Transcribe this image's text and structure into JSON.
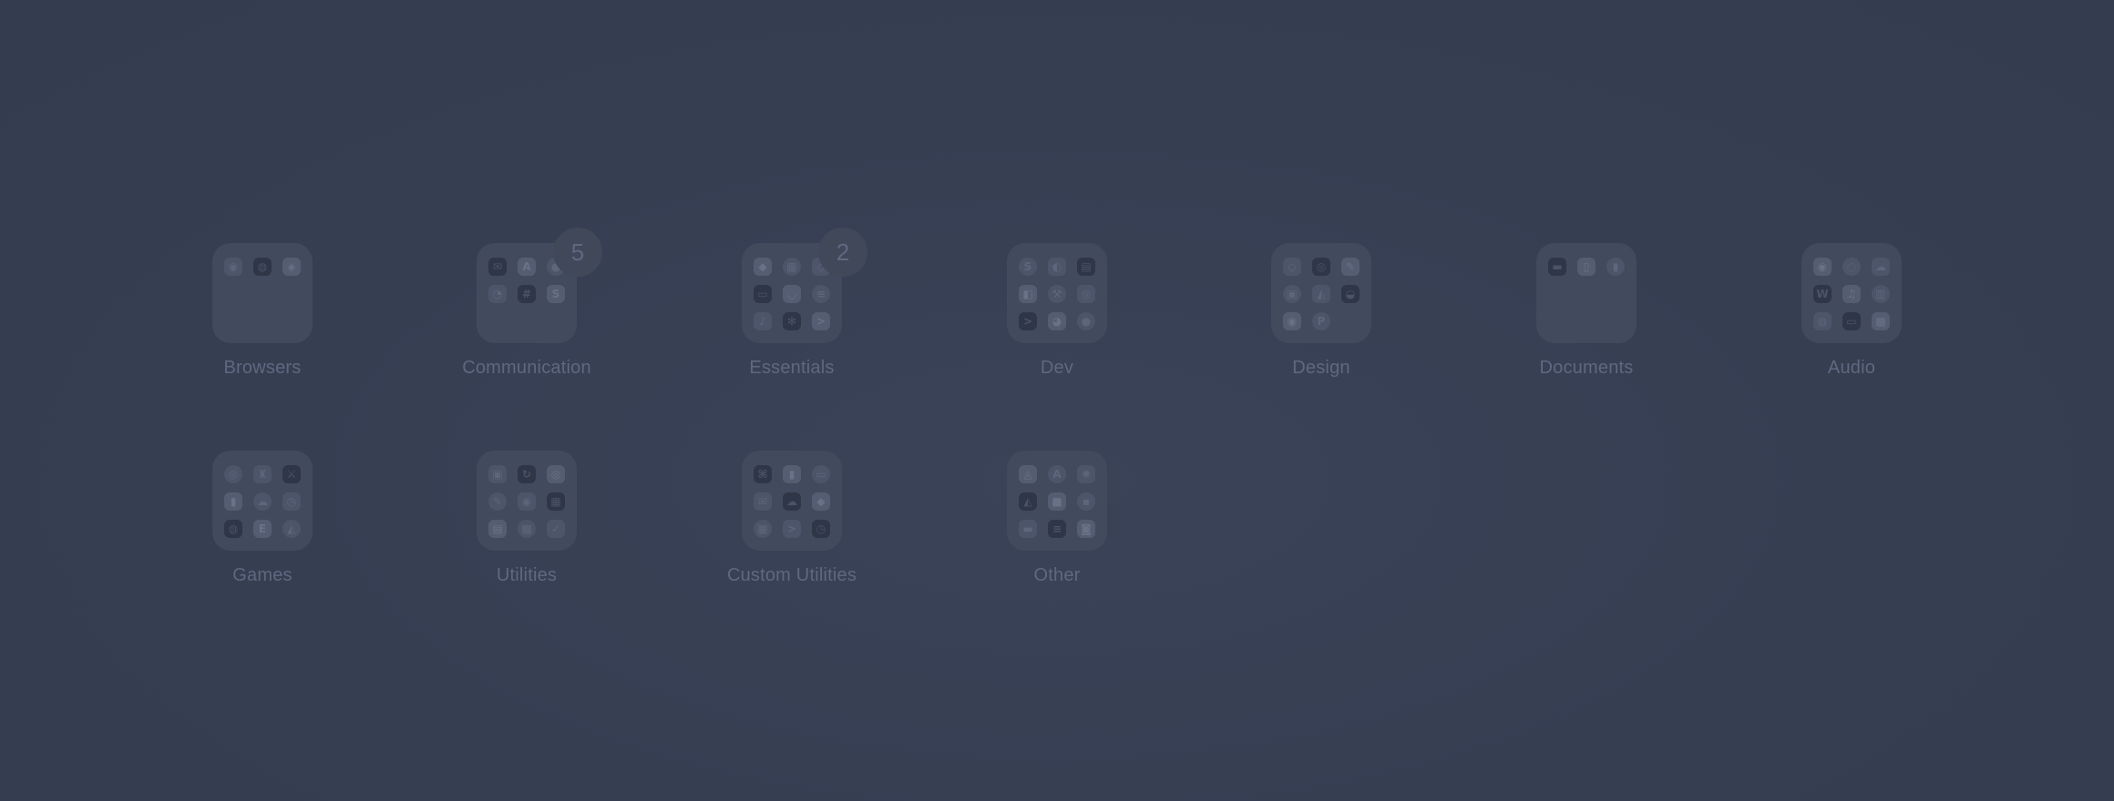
{
  "folders": [
    {
      "label": "Browsers",
      "badge": "",
      "icons": [
        "chrome-icon",
        "firefox-icon",
        "safari-icon"
      ]
    },
    {
      "label": "Communication",
      "badge": "5",
      "icons": [
        "mail-icon",
        "appstore-icon",
        "messages-icon",
        "discord-icon",
        "slack-icon",
        "skype-icon"
      ]
    },
    {
      "label": "Essentials",
      "badge": "2",
      "icons": [
        "shield-icon",
        "grid-icon",
        "dropbox-icon",
        "keyboard-icon",
        "pocket-icon",
        "notes-icon",
        "music-icon",
        "settings-icon",
        "terminal-icon"
      ]
    },
    {
      "label": "Dev",
      "badge": "",
      "icons": [
        "sublime-icon",
        "gitkraken-icon",
        "docker-icon",
        "vscode-icon",
        "xcode-icon",
        "database-icon",
        "terminal-icon",
        "github-icon",
        "postman-icon"
      ]
    },
    {
      "label": "Design",
      "badge": "",
      "icons": [
        "sketch-icon",
        "dribbble-icon",
        "pen-icon",
        "invision-icon",
        "framer-icon",
        "zeplin-icon",
        "figma-icon",
        "photoshop-icon"
      ]
    },
    {
      "label": "Documents",
      "badge": "",
      "icons": [
        "keynote-icon",
        "pages-icon",
        "numbers-icon"
      ]
    },
    {
      "label": "Audio",
      "badge": "",
      "icons": [
        "podcast-icon",
        "spotify-icon",
        "soundcloud-icon",
        "wordpress-icon",
        "audio-icon",
        "equalizer-icon",
        "globe-icon",
        "radio-icon",
        "mixer-icon"
      ]
    },
    {
      "label": "Games",
      "badge": "",
      "icons": [
        "steam-icon",
        "chess-icon",
        "sword-icon",
        "chart-icon",
        "cloud-icon",
        "clock-icon",
        "controller-icon",
        "epic-icon",
        "racing-icon"
      ]
    },
    {
      "label": "Utilities",
      "badge": "",
      "icons": [
        "monitor-icon",
        "sync-icon",
        "compass-icon",
        "pencil-icon",
        "target-icon",
        "calendar-icon",
        "archive-icon",
        "calculator-icon",
        "checkmark-icon"
      ]
    },
    {
      "label": "Custom Utilities",
      "badge": "",
      "icons": [
        "code-icon",
        "lock-icon",
        "chat-icon",
        "mail-icon",
        "cloud-icon",
        "shield-icon",
        "grid-icon",
        "terminal-icon",
        "clock-icon"
      ]
    },
    {
      "label": "Other",
      "badge": "",
      "icons": [
        "bag-icon",
        "ai-icon",
        "sun-icon",
        "map-icon",
        "square-icon",
        "box-icon",
        "card-icon",
        "notes-icon",
        "camera-icon"
      ]
    }
  ],
  "icon_glyphs": {
    "chrome-icon": "◉",
    "firefox-icon": "◍",
    "safari-icon": "◈",
    "mail-icon": "✉",
    "appstore-icon": "A",
    "messages-icon": "●",
    "discord-icon": "◔",
    "slack-icon": "#",
    "skype-icon": "S",
    "shield-icon": "◆",
    "grid-icon": "▦",
    "dropbox-icon": "◇",
    "keyboard-icon": "▭",
    "pocket-icon": "◡",
    "notes-icon": "≡",
    "music-icon": "♪",
    "settings-icon": "✻",
    "terminal-icon": ">",
    "sublime-icon": "S",
    "gitkraken-icon": "◐",
    "docker-icon": "▤",
    "vscode-icon": "◧",
    "xcode-icon": "⚒",
    "database-icon": "◎",
    "github-icon": "◕",
    "postman-icon": "●",
    "sketch-icon": "◇",
    "dribbble-icon": "◎",
    "pen-icon": "✎",
    "invision-icon": "▣",
    "framer-icon": "◭",
    "zeplin-icon": "◒",
    "figma-icon": "◉",
    "photoshop-icon": "P",
    "keynote-icon": "▬",
    "pages-icon": "▯",
    "numbers-icon": "▮",
    "podcast-icon": "◉",
    "spotify-icon": "◌",
    "soundcloud-icon": "☁",
    "wordpress-icon": "W",
    "audio-icon": "♫",
    "equalizer-icon": "▥",
    "globe-icon": "◍",
    "radio-icon": "▭",
    "mixer-icon": "▩",
    "steam-icon": "◎",
    "chess-icon": "♜",
    "sword-icon": "⚔",
    "chart-icon": "▮",
    "cloud-icon": "☁",
    "clock-icon": "◷",
    "controller-icon": "◍",
    "epic-icon": "E",
    "racing-icon": "◭",
    "monitor-icon": "▣",
    "sync-icon": "↻",
    "compass-icon": "◎",
    "pencil-icon": "✎",
    "target-icon": "◉",
    "calendar-icon": "▦",
    "archive-icon": "▤",
    "calculator-icon": "▩",
    "checkmark-icon": "✓",
    "code-icon": "⌘",
    "lock-icon": "▮",
    "chat-icon": "▭",
    "bag-icon": "◬",
    "ai-icon": "A",
    "sun-icon": "✺",
    "map-icon": "◭",
    "square-icon": "■",
    "box-icon": "▪",
    "card-icon": "▬",
    "camera-icon": "◙"
  },
  "colors": {
    "background": "#363e52",
    "tile": "#424a5e",
    "label": "#5f6880",
    "badge": "#404859"
  }
}
